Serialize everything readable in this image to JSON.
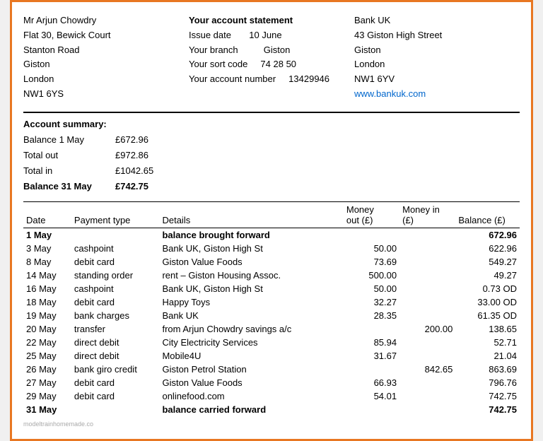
{
  "header": {
    "customer": {
      "name": "Mr Arjun Chowdry",
      "address1": "Flat 30, Bewick Court",
      "address2": "Stanton Road",
      "address3": "Giston",
      "address4": "London",
      "address5": "NW1 6YS"
    },
    "account": {
      "title": "Your account statement",
      "issue_date_label": "Issue date",
      "issue_date_value": "10 June",
      "branch_label": "Your branch",
      "branch_value": "Giston",
      "sort_code_label": "Your sort code",
      "sort_code_value": "74 28 50",
      "account_number_label": "Your account number",
      "account_number_value": "13429946"
    },
    "bank": {
      "name": "Bank UK",
      "address1": "43 Giston High Street",
      "address2": "Giston",
      "address3": "London",
      "address4": "NW1 6YV",
      "website": "www.bankuk.com"
    }
  },
  "summary": {
    "title": "Account summary:",
    "rows": [
      {
        "label": "Balance 1 May",
        "value": "£672.96",
        "bold": false
      },
      {
        "label": "Total out",
        "value": "£972.86",
        "bold": false
      },
      {
        "label": "Total in",
        "value": "£1042.65",
        "bold": false
      },
      {
        "label": "Balance 31 May",
        "value": "£742.75",
        "bold": true
      }
    ]
  },
  "table": {
    "columns": {
      "date": "Date",
      "payment_type": "Payment type",
      "details": "Details",
      "money_out": "Money out (£)",
      "money_in": "Money in (£)",
      "balance": "Balance (£)"
    },
    "rows": [
      {
        "date": "1 May",
        "payment": "",
        "details": "balance brought forward",
        "out": "",
        "in": "",
        "balance": "672.96",
        "bold": true
      },
      {
        "date": "3 May",
        "payment": "cashpoint",
        "details": "Bank UK, Giston High St",
        "out": "50.00",
        "in": "",
        "balance": "622.96",
        "bold": false
      },
      {
        "date": "8 May",
        "payment": "debit card",
        "details": "Giston Value Foods",
        "out": "73.69",
        "in": "",
        "balance": "549.27",
        "bold": false
      },
      {
        "date": "14 May",
        "payment": "standing order",
        "details": "rent – Giston Housing Assoc.",
        "out": "500.00",
        "in": "",
        "balance": "49.27",
        "bold": false
      },
      {
        "date": "16 May",
        "payment": "cashpoint",
        "details": "Bank UK, Giston High St",
        "out": "50.00",
        "in": "",
        "balance": "0.73 OD",
        "bold": false
      },
      {
        "date": "18 May",
        "payment": "debit card",
        "details": "Happy Toys",
        "out": "32.27",
        "in": "",
        "balance": "33.00 OD",
        "bold": false
      },
      {
        "date": "19 May",
        "payment": "bank charges",
        "details": "Bank UK",
        "out": "28.35",
        "in": "",
        "balance": "61.35 OD",
        "bold": false
      },
      {
        "date": "20 May",
        "payment": "transfer",
        "details": "from Arjun Chowdry savings a/c",
        "out": "",
        "in": "200.00",
        "balance": "138.65",
        "bold": false
      },
      {
        "date": "22 May",
        "payment": "direct debit",
        "details": "City Electricity Services",
        "out": "85.94",
        "in": "",
        "balance": "52.71",
        "bold": false
      },
      {
        "date": "25 May",
        "payment": "direct debit",
        "details": "Mobile4U",
        "out": "31.67",
        "in": "",
        "balance": "21.04",
        "bold": false
      },
      {
        "date": "26 May",
        "payment": "bank giro credit",
        "details": "Giston Petrol Station",
        "out": "",
        "in": "842.65",
        "balance": "863.69",
        "bold": false
      },
      {
        "date": "27 May",
        "payment": "debit card",
        "details": "Giston Value Foods",
        "out": "66.93",
        "in": "",
        "balance": "796.76",
        "bold": false
      },
      {
        "date": "29 May",
        "payment": "debit card",
        "details": "onlinefood.com",
        "out": "54.01",
        "in": "",
        "balance": "742.75",
        "bold": false
      },
      {
        "date": "31 May",
        "payment": "",
        "details": "balance carried forward",
        "out": "",
        "in": "",
        "balance": "742.75",
        "bold": true
      }
    ]
  },
  "watermark": "modeltrainhomemade.co"
}
